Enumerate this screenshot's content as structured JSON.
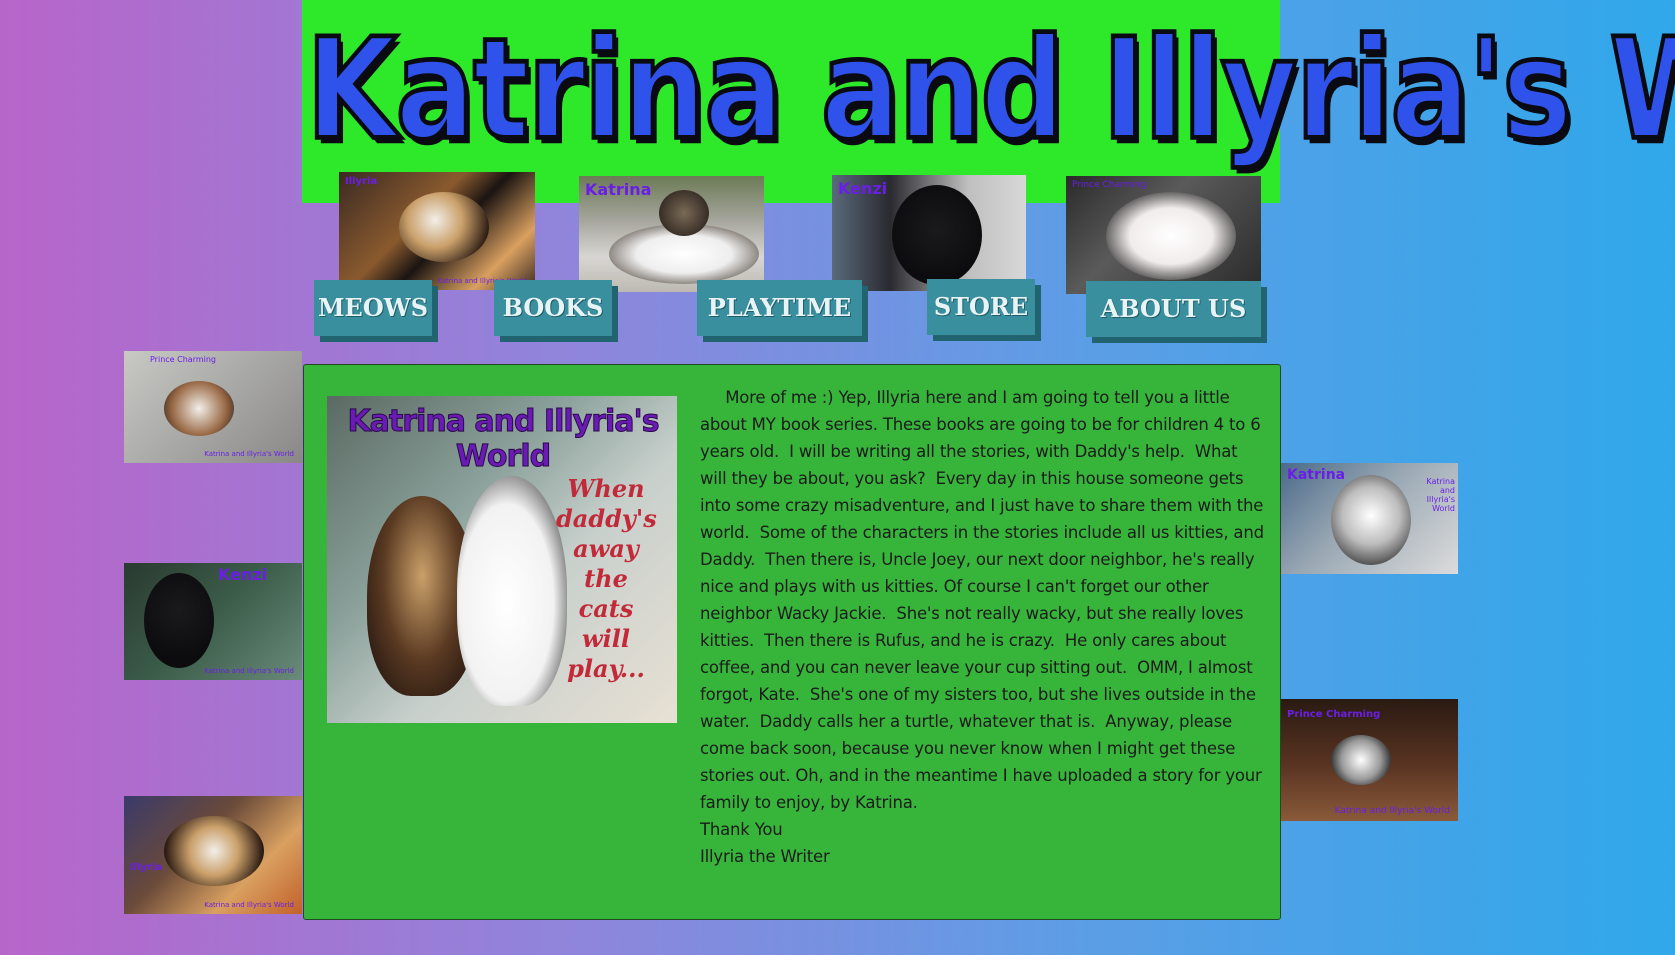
{
  "site": {
    "title": "Katrina and Illyria's World",
    "header_bg": "#2ee82a",
    "title_color": "#2f52ea"
  },
  "header_photos": [
    {
      "label": "Illyria",
      "watermark": "Katrina and Illyria's World"
    },
    {
      "label": "Katrina",
      "watermark": ""
    },
    {
      "label": "Kenzi",
      "watermark": ""
    },
    {
      "label": "Prince Charming",
      "watermark": ""
    }
  ],
  "nav": [
    {
      "label": "MEOWS"
    },
    {
      "label": "BOOKS"
    },
    {
      "label": "PLAYTIME"
    },
    {
      "label": "STORE"
    },
    {
      "label": "ABOUT US"
    }
  ],
  "side_photos_left": [
    {
      "label": "Prince Charming",
      "watermark": "Katrina and Illyria's World"
    },
    {
      "label": "Kenzi",
      "watermark": "Katrina and Illyria's World"
    },
    {
      "label": "Illyria",
      "watermark": "Katrina and Illyria's World"
    }
  ],
  "side_photos_right": [
    {
      "label": "Katrina",
      "watermark": "Katrina and Illyria's World"
    },
    {
      "label": "Prince Charming",
      "watermark": "Katrina and Illyria's World"
    }
  ],
  "book": {
    "title": "Katrina and Illyria's World",
    "subtitle": "When daddy's away the cats will play..."
  },
  "content": {
    "paragraph": "     More of me :) Yep, Illyria here and I am going to tell you a little about MY book series. These books are going to be for children 4 to 6 years old.  I will be writing all the stories, with Daddy's help.  What will they be about, you ask?  Every day in this house someone gets into some crazy misadventure, and I just have to share them with the world.  Some of the characters in the stories include all us kitties, and Daddy.  Then there is, Uncle Joey, our next door neighbor, he's really nice and plays with us kitties. Of course I can't forget our other neighbor Wacky Jackie.  She's not really wacky, but she really loves kitties.  Then there is Rufus, and he is crazy.  He only cares about coffee, and you can never leave your cup sitting out.  OMM, I almost forgot, Kate.  She's one of my sisters too, but she lives outside in the water.  Daddy calls her a turtle, whatever that is.  Anyway, please come back soon, because you never know when I might get these stories out. Oh, and in the meantime I have uploaded a story for your family to enjoy, by Katrina.",
    "closing": "Thank You",
    "signature": "Illyria the Writer"
  },
  "colors": {
    "content_bg": "#37b53b",
    "nav_bg": "#3a8f9f",
    "label_purple": "#6a1ee6"
  }
}
